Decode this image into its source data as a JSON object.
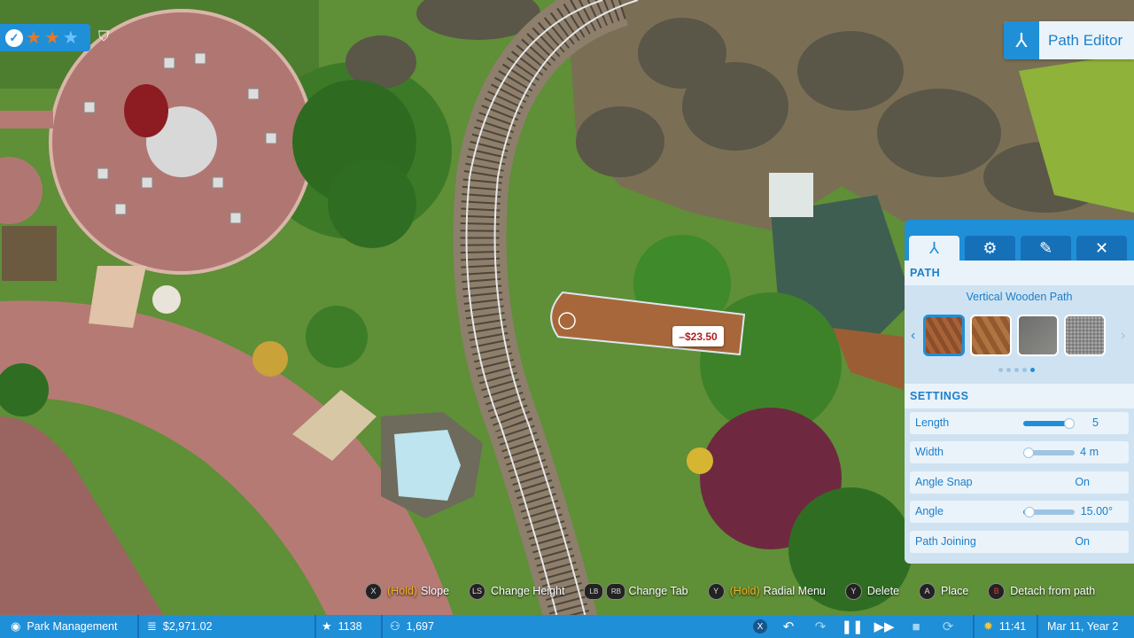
{
  "hud": {
    "rating_icon": "verified-check-icon",
    "stars_on": 2,
    "stars_total": 3,
    "guest_icon": "guest-counter-icon"
  },
  "path_editor": {
    "title": "Path Editor",
    "icon": "path-icon",
    "tabs": [
      {
        "name": "tab-path",
        "icon": "path-icon",
        "glyph": "⅄"
      },
      {
        "name": "tab-settings",
        "icon": "gear-icon",
        "glyph": "⚙"
      },
      {
        "name": "tab-style",
        "icon": "paint-icon",
        "glyph": "✎"
      },
      {
        "name": "tab-demolish",
        "icon": "demolish-icon",
        "glyph": "✕"
      }
    ],
    "path_section": "PATH",
    "selected_path": "Vertical Wooden Path",
    "settings_section": "SETTINGS",
    "settings": [
      {
        "label": "Length",
        "value": "5",
        "slider": 0.9
      },
      {
        "label": "Width",
        "value": "4 m",
        "slider": 0.0
      },
      {
        "label": "Angle Snap",
        "value": "On"
      },
      {
        "label": "Angle",
        "value": "15.00°",
        "slider": 0.12
      },
      {
        "label": "Path Joining",
        "value": "On"
      }
    ]
  },
  "cost_tag": "–$23.50",
  "hints": [
    {
      "button": "X",
      "hold": "(Hold)",
      "label": "Slope"
    },
    {
      "button": "LS",
      "hold": "",
      "label": "Change Height"
    },
    {
      "button": "LB",
      "button2": "RB",
      "hold": "",
      "label": "Change Tab"
    },
    {
      "button": "Y",
      "hold": "(Hold)",
      "label": "Radial Menu"
    },
    {
      "button": "Y",
      "hold": "",
      "label": "Delete"
    },
    {
      "button": "A",
      "hold": "",
      "label": "Place"
    },
    {
      "button": "B",
      "hold": "",
      "label": "Detach from path"
    }
  ],
  "bottom_bar": {
    "park_management": "Park Management",
    "money": "$2,971.02",
    "rating": "1138",
    "guests": "1,697",
    "time": "11:41",
    "date": "Mar 11, Year 2",
    "controls": [
      "X",
      "undo-icon",
      "redo-icon",
      "pause-icon",
      "fast-forward-icon",
      "camera-icon",
      "rotate-icon"
    ]
  }
}
